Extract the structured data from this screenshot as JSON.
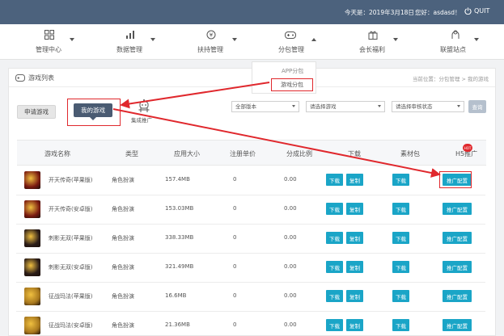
{
  "header": {
    "date": "今天是：2019年3月18日",
    "greeting": "您好：asdasd！",
    "quit": "QUIT"
  },
  "nav": {
    "items": [
      {
        "label": "管理中心",
        "icon": "grid-icon"
      },
      {
        "label": "数据管理",
        "icon": "bar-chart-icon"
      },
      {
        "label": "扶持管理",
        "icon": "coin-icon"
      },
      {
        "label": "分包管理",
        "icon": "gamepad-icon"
      },
      {
        "label": "会长福利",
        "icon": "gift-icon"
      },
      {
        "label": "联盟站点",
        "icon": "alliance-icon"
      }
    ],
    "dropdown": {
      "item1": "APP分包",
      "item2": "游戏分包"
    }
  },
  "panel": {
    "title": "游戏列表",
    "breadcrumb": "当前位置：分包管理 > 我的游戏",
    "apply_button": "申请游戏",
    "mygames_button": "我的游戏",
    "integrate_label": "集成推广",
    "filters": {
      "version": "全部版本",
      "game": "请选择游戏",
      "status": "请选择审核状态",
      "query": "查询"
    }
  },
  "table": {
    "headers": [
      "游戏名称",
      "类型",
      "应用大小",
      "注册单价",
      "分成比例",
      "下载",
      "素材包",
      "H5推广"
    ],
    "hot_badge": "HOT",
    "download_label": "下载",
    "copy_label": "复制",
    "promo_label": "推广配置",
    "rows": [
      {
        "name": "开天传奇(苹果版)",
        "type": "角色扮演",
        "size": "157.4MB",
        "price": "0",
        "ratio": "0.00",
        "thumb_color": "#7a1a10"
      },
      {
        "name": "开天传奇(安卓版)",
        "type": "角色扮演",
        "size": "153.03MB",
        "price": "0",
        "ratio": "0.00",
        "thumb_color": "#7a1a10"
      },
      {
        "name": "刺影无双(苹果版)",
        "type": "角色扮演",
        "size": "338.33MB",
        "price": "0",
        "ratio": "0.00",
        "thumb_color": "#2a1c18"
      },
      {
        "name": "刺影无双(安卓版)",
        "type": "角色扮演",
        "size": "321.49MB",
        "price": "0",
        "ratio": "0.00",
        "thumb_color": "#2a1c18"
      },
      {
        "name": "征战玛法(苹果版)",
        "type": "角色扮演",
        "size": "16.6MB",
        "price": "0",
        "ratio": "0.00",
        "thumb_color": "#a8781e"
      },
      {
        "name": "征战玛法(安卓版)",
        "type": "角色扮演",
        "size": "21.36MB",
        "price": "0",
        "ratio": "0.00",
        "thumb_color": "#a8781e"
      }
    ]
  },
  "colors": {
    "topbar": "#4c627d",
    "action": "#1aa5c7",
    "highlight": "#e0282d",
    "dark_button": "#4a5b72"
  }
}
